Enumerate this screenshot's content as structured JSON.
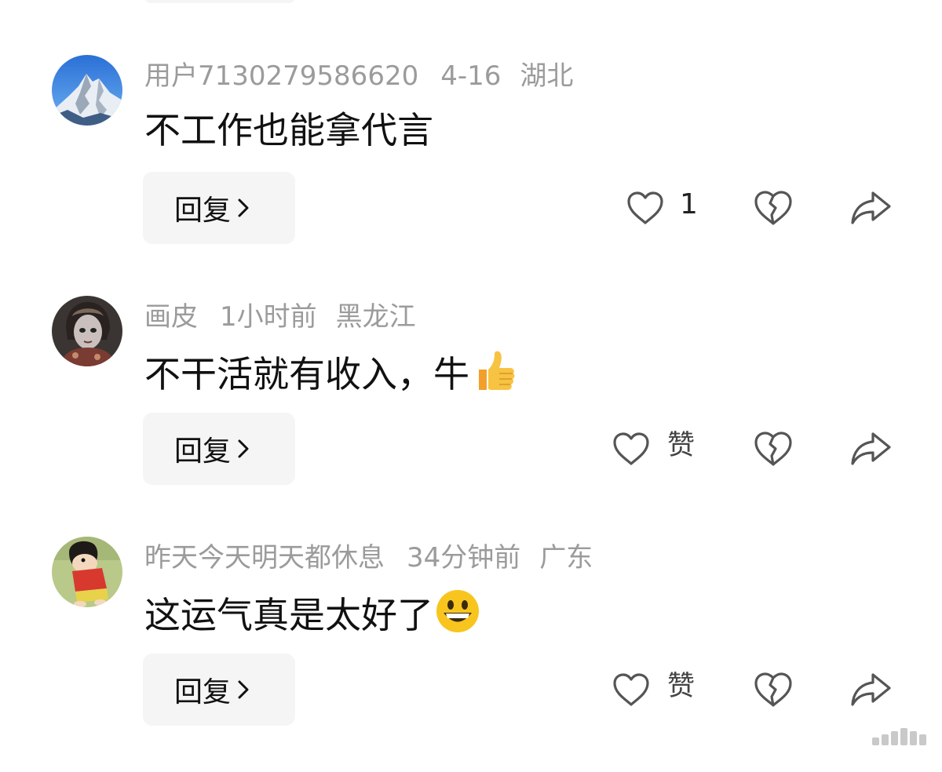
{
  "comments": [
    {
      "username": "用户7130279586620",
      "time": "4-16",
      "location": "湖北",
      "text": "不工作也能拿代言",
      "reply_label": "回复",
      "like_label": "1",
      "avatar_icon": "snowy-mountain-avatar",
      "text_emoji": ""
    },
    {
      "username": "画皮",
      "time": "1小时前",
      "location": "黑龙江",
      "text": "不干活就有收入，牛",
      "reply_label": "回复",
      "like_label": "赞",
      "avatar_icon": "painted-skin-portrait-avatar",
      "text_emoji": "thumbs-up-emoji"
    },
    {
      "username": "昨天今天明天都休息",
      "time": "34分钟前",
      "location": "广东",
      "text": "这运气真是太好了",
      "reply_label": "回复",
      "like_label": "赞",
      "avatar_icon": "cartoon-boy-avatar",
      "text_emoji": "grinning-face-emoji"
    }
  ],
  "icons": {
    "like": "heart-outline-icon",
    "dislike": "broken-heart-icon",
    "share": "share-arrow-icon",
    "reply_chevron": "chevron-right-icon"
  },
  "colors": {
    "meta_text": "#9b9b9b",
    "body_text": "#111111",
    "reply_bg": "#f5f5f5",
    "icon_stroke": "#555555"
  }
}
